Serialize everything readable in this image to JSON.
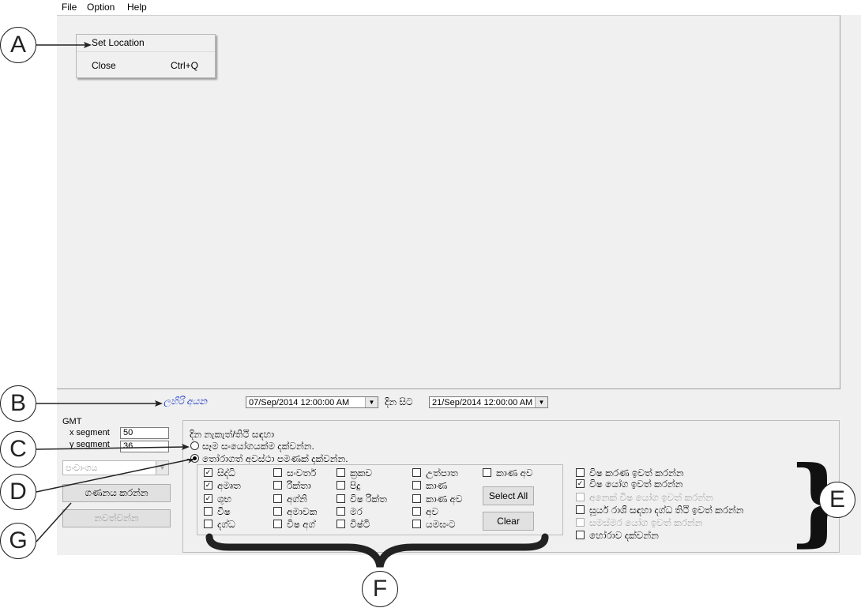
{
  "menu": {
    "file": "File",
    "option": "Option",
    "help": "Help"
  },
  "file_menu": {
    "set_location": "Set Location",
    "close": "Close",
    "close_shortcut": "Ctrl+Q"
  },
  "date_row": {
    "label": "ලහිරි අයන",
    "start_date": "07/Sep/2014 12:00:00 AM",
    "mid_label": "දින සිට",
    "end_date": "21/Sep/2014 12:00:00 AM"
  },
  "left_panel": {
    "gmt_label": "GMT",
    "x_segment_label": "x segment",
    "x_segment_value": "50",
    "y_segment_label": "y segment",
    "y_segment_value": "36",
    "panchanga_select": "පංචාංගය",
    "calculate_button": "ගණනය කරන්න",
    "stop_button": "නවත්වන්න"
  },
  "group": {
    "title": "දින නැකැත්/තිථි සඳහා",
    "radio_all": "සෑම සංයෝගයක්ම දක්වන්න.",
    "radio_selected": "තෝරාගත් අවස්ථා පමණක් දක්වන්න."
  },
  "yoga_checkboxes": [
    {
      "label": "සිද්ධි",
      "checked": true
    },
    {
      "label": "අමෘත",
      "checked": true
    },
    {
      "label": "ශුභ",
      "checked": true
    },
    {
      "label": "විෂ",
      "checked": false
    },
    {
      "label": "දග්ධ",
      "checked": false
    },
    {
      "label": "සංවර්ත",
      "checked": false
    },
    {
      "label": "රික්තා",
      "checked": false
    },
    {
      "label": "අග්නි",
      "checked": false
    },
    {
      "label": "අමාවක",
      "checked": false
    },
    {
      "label": "විෂ අග්",
      "checked": false
    },
    {
      "label": "ක්‍රකච",
      "checked": false
    },
    {
      "label": "පිදු",
      "checked": false
    },
    {
      "label": "විෂ රික්ත",
      "checked": false
    },
    {
      "label": "මර",
      "checked": false
    },
    {
      "label": "විෂ්ටි",
      "checked": false
    },
    {
      "label": "උත්පාත",
      "checked": false
    },
    {
      "label": "කාණ",
      "checked": false
    },
    {
      "label": "කාණ අව",
      "checked": false
    },
    {
      "label": "අව",
      "checked": false
    },
    {
      "label": "යමඝංට",
      "checked": false
    },
    {
      "label": "කාණ අව",
      "checked": false
    }
  ],
  "buttons": {
    "select_all": "Select All",
    "clear": "Clear"
  },
  "options": [
    {
      "label": "විෂ කරණ ඉවත් කරන්න",
      "checked": false,
      "enabled": true
    },
    {
      "label": "විෂ යෝග ඉවත් කරන්න",
      "checked": true,
      "enabled": true
    },
    {
      "label": "අනෙක් විෂ යෝග ඉවත් කරන්න",
      "checked": false,
      "enabled": false
    },
    {
      "label": "සූර්ය රාශි සඳහා දග්ධ තිථි ඉවත් කරන්න",
      "checked": false,
      "enabled": true
    },
    {
      "label": "සමස්මර යෝග ඉවත් කරන්න",
      "checked": false,
      "enabled": false
    },
    {
      "label": "හෝරාව දක්වන්න",
      "checked": false,
      "enabled": true
    }
  ],
  "callouts": {
    "a": "A",
    "b": "B",
    "c": "C",
    "d": "D",
    "e": "E",
    "f": "F",
    "g": "G"
  },
  "brace_right": "}"
}
